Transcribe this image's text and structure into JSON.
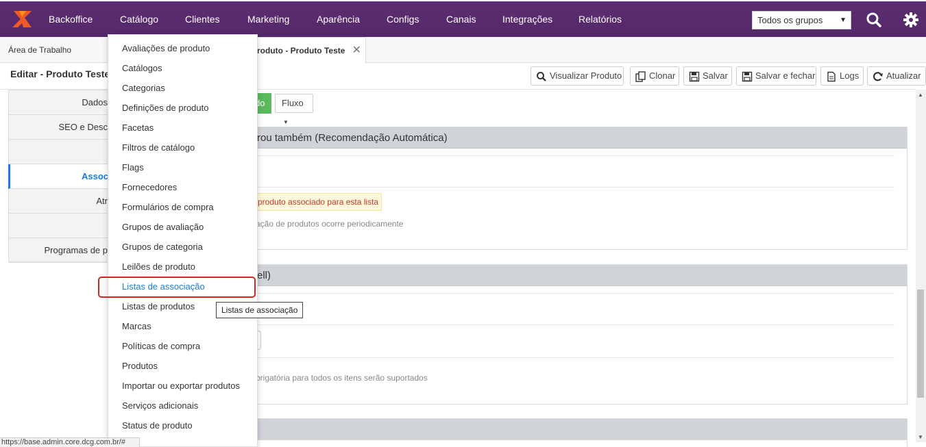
{
  "nav": {
    "items": [
      "Backoffice",
      "Catálogo",
      "Clientes",
      "Marketing",
      "Aparência",
      "Configs",
      "Canais",
      "Integrações",
      "Relatórios"
    ],
    "group_select": "Todos os grupos",
    "brand_color": "#5a2d6e"
  },
  "tabs": {
    "desktop": "Área de Trabalho",
    "product": "roduto - Produto Teste"
  },
  "page": {
    "title": "Editar - Produto Teste"
  },
  "toolbar": {
    "view": "Visualizar Produto",
    "clone": "Clonar",
    "save": "Salvar",
    "save_close": "Salvar e fechar",
    "logs": "Logs",
    "refresh": "Atualizar"
  },
  "sidemenu": {
    "items": [
      "Dados",
      "SEO e Desc",
      "",
      "Assoc",
      "Atr",
      "",
      "Programas de p"
    ]
  },
  "main": {
    "status_badge": "do",
    "flow_button": "Fluxo",
    "panel1_title": "rou também (Recomendação Automática)",
    "panel1_warning": "produto associado para esta lista",
    "panel1_hint": "ação de produtos ocorre periodicamente",
    "panel2_title": "ell)",
    "panel2_hint": "brigatória para todos os itens serão suportados"
  },
  "dropdown": {
    "items": [
      "Avaliações de produto",
      "Catálogos",
      "Categorias",
      "Definições de produto",
      "Facetas",
      "Filtros de catálogo",
      "Flags",
      "Fornecedores",
      "Formulários de compra",
      "Grupos de avaliação",
      "Grupos de categoria",
      "Leilões de produto",
      "Listas de associação",
      "Listas de produtos",
      "Marcas",
      "Políticas de compra",
      "Produtos",
      "Importar ou exportar produtos",
      "Serviços adicionais",
      "Status de produto"
    ],
    "tooltip": "Listas de associação"
  },
  "statusbar": "https://base.admin.core.dcg.com.br/#"
}
